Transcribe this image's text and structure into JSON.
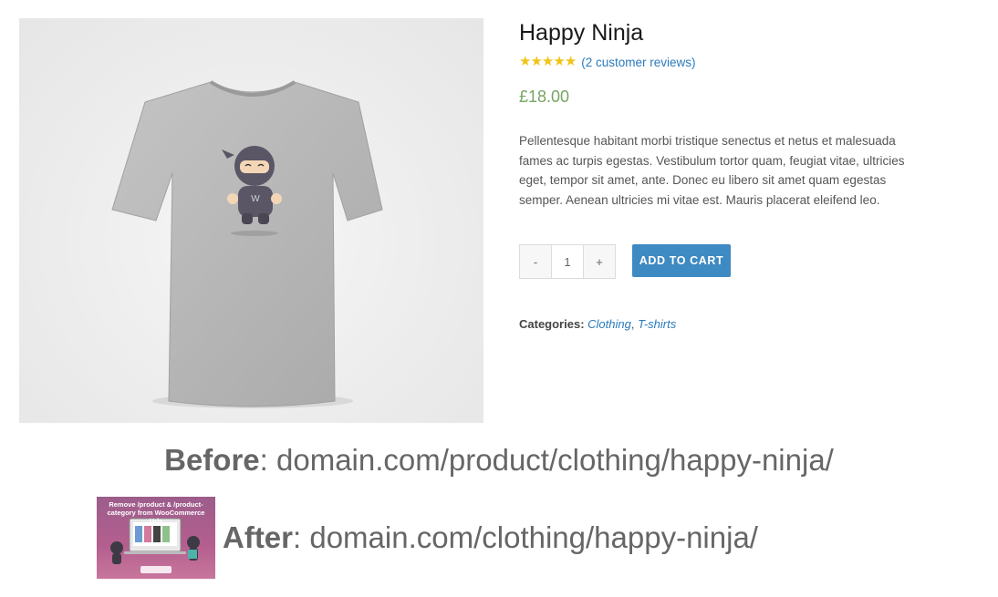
{
  "product": {
    "title": "Happy Ninja",
    "rating": 5,
    "rating_max": 5,
    "reviews_label": "(2 customer reviews)",
    "price": "£18.00",
    "description": "Pellentesque habitant morbi tristique senectus et netus et malesuada fames ac turpis egestas. Vestibulum tortor quam, feugiat vitae, ultricies eget, tempor sit amet, ante. Donec eu libero sit amet quam egestas semper. Aenean ultricies mi vitae est. Mauris placerat eleifend leo.",
    "quantity": {
      "minus_label": "-",
      "value": "1",
      "plus_label": "+"
    },
    "add_to_cart_label": "ADD TO CART",
    "categories_label": "Categories:",
    "categories": [
      "Clothing",
      "T-shirts"
    ],
    "categories_separator": ", ",
    "shirt_logo_letter": "W"
  },
  "colors": {
    "price": "#77a464",
    "link": "#2a7bbd",
    "button": "#3e8ac2",
    "star": "#f0c419",
    "shirt": "#b9b9b9"
  },
  "before": {
    "label": "Before",
    "url": ": domain.com/product/clothing/happy-ninja/"
  },
  "after": {
    "label": "After",
    "url": ": domain.com/clothing/happy-ninja/",
    "thumbnail_title": "Remove /product & /product-category from WooCommerce Urls"
  }
}
